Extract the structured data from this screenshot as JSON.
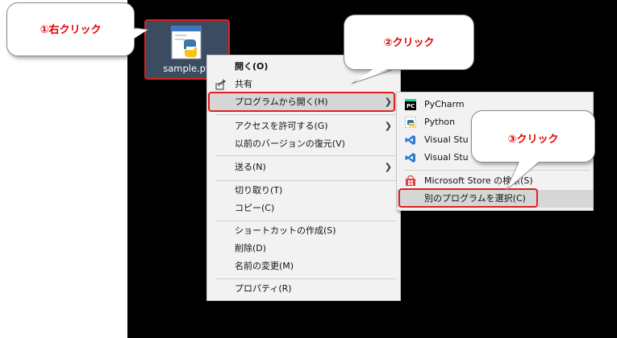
{
  "file": {
    "name": "sample.py",
    "icon": "python-file-icon"
  },
  "callouts": [
    {
      "text": "①右クリック"
    },
    {
      "text": "②クリック"
    },
    {
      "text": "③クリック"
    }
  ],
  "context_menu": {
    "items": [
      {
        "label": "開く(O)",
        "bold": true
      },
      {
        "label": "共有",
        "icon": "share-icon"
      },
      {
        "label": "プログラムから開く(H)",
        "submenu": true
      },
      {
        "label": "アクセスを許可する(G)",
        "submenu": true
      },
      {
        "label": "以前のバージョンの復元(V)"
      },
      {
        "label": "送る(N)",
        "submenu": true
      },
      {
        "label": "切り取り(T)"
      },
      {
        "label": "コピー(C)"
      },
      {
        "label": "ショートカットの作成(S)"
      },
      {
        "label": "削除(D)"
      },
      {
        "label": "名前の変更(M)"
      },
      {
        "label": "プロパティ(R)"
      }
    ]
  },
  "open_with_menu": {
    "items": [
      {
        "label": "PyCharm",
        "icon": "pycharm-icon"
      },
      {
        "label": "Python",
        "icon": "python-icon"
      },
      {
        "label": "Visual Stu",
        "icon": "visual-studio-icon"
      },
      {
        "label": "Visual Stu",
        "icon": "visual-studio-icon"
      },
      {
        "label": "Microsoft Store の検索(S)",
        "icon": "store-icon"
      },
      {
        "label": "別のプログラムを選択(C)"
      }
    ]
  },
  "colors": {
    "accent_red": "#e02020",
    "desktop": "#000000"
  }
}
